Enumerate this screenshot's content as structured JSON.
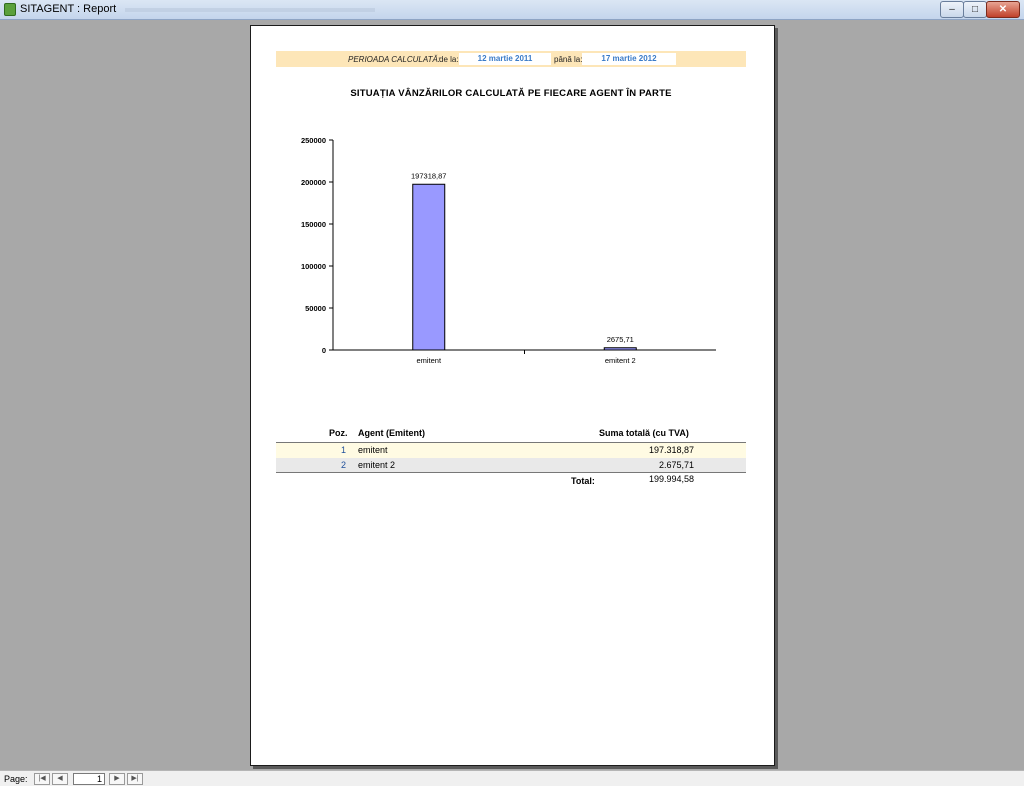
{
  "window": {
    "title": "SITAGENT : Report",
    "buttons": {
      "minimize": "–",
      "maximize": "□",
      "close": "✕"
    }
  },
  "report": {
    "period": {
      "label": "PERIOADA CALCULATĂ:",
      "from_label": "de la:",
      "from_value": "12 martie 2011",
      "to_label": "până la:",
      "to_value": "17 martie 2012"
    },
    "title": "SITUAȚIA VÂNZĂRILOR CALCULATĂ PE FIECARE AGENT ÎN PARTE",
    "table": {
      "headers": {
        "poz": "Poz.",
        "agent": "Agent (Emitent)",
        "sum": "Suma totală (cu TVA)"
      },
      "rows": [
        {
          "poz": "1",
          "agent": "emitent",
          "sum": "197.318,87"
        },
        {
          "poz": "2",
          "agent": "emitent 2",
          "sum": "2.675,71"
        }
      ],
      "total_label": "Total:",
      "total_value": "199.994,58"
    }
  },
  "chart_data": {
    "type": "bar",
    "categories": [
      "emitent",
      "emitent 2"
    ],
    "values": [
      197318.87,
      2675.71
    ],
    "data_labels": [
      "197318,87",
      "2675,71"
    ],
    "ylim": [
      0,
      250000
    ],
    "yticks": [
      "0",
      "50000",
      "100000",
      "150000",
      "200000",
      "250000"
    ],
    "bar_color": "#9999ff",
    "grid": false,
    "title": "",
    "xlabel": "",
    "ylabel": ""
  },
  "statusbar": {
    "page_label": "Page:",
    "page_value": "1",
    "nav": {
      "first": "|◀",
      "prev": "◀",
      "next": "▶",
      "last": "▶|"
    }
  }
}
